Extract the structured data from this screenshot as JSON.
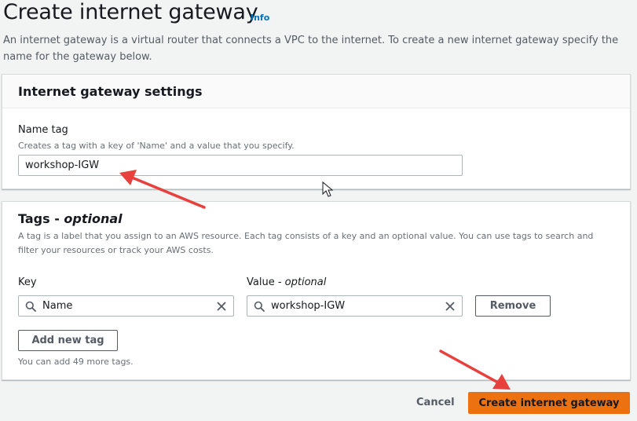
{
  "header": {
    "title": "Create internet gateway",
    "info_label": "Info",
    "description": "An internet gateway is a virtual router that connects a VPC to the internet. To create a new internet gateway specify the name for the gateway below."
  },
  "settings_panel": {
    "title": "Internet gateway settings",
    "name_tag_label": "Name tag",
    "name_tag_hint": "Creates a tag with a key of 'Name' and a value that you specify.",
    "name_tag_value": "workshop-IGW"
  },
  "tags_panel": {
    "title_main": "Tags - ",
    "title_optional": "optional",
    "description": "A tag is a label that you assign to an AWS resource. Each tag consists of a key and an optional value. You can use tags to search and filter your resources or track your AWS costs.",
    "key_label": "Key",
    "value_label_main": "Value - ",
    "value_label_optional": "optional",
    "tags": [
      {
        "key": "Name",
        "value": "workshop-IGW"
      }
    ],
    "remove_label": "Remove",
    "add_label": "Add new tag",
    "remaining_hint": "You can add 49 more tags."
  },
  "footer": {
    "cancel_label": "Cancel",
    "create_label": "Create internet gateway"
  },
  "colors": {
    "primary": "#ec7211",
    "link": "#0073bb",
    "annotation_arrow": "#e8403d"
  }
}
